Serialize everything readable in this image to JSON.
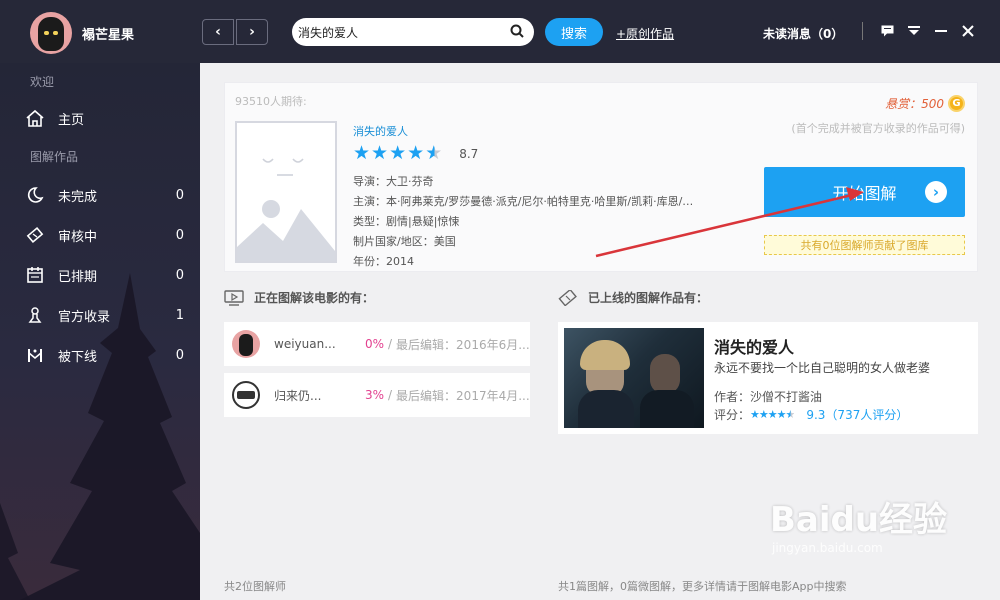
{
  "user": {
    "name": "褟芒星果"
  },
  "topbar": {
    "search_value": "消失的爱人",
    "search_button": "搜索",
    "original_link": "+原创作品",
    "unread": "未读消息（0）"
  },
  "sidebar": {
    "welcome": "欢迎",
    "home": "主页",
    "works_label": "图解作品",
    "items": [
      {
        "label": "未完成",
        "count": "0"
      },
      {
        "label": "审核中",
        "count": "0"
      },
      {
        "label": "已排期",
        "count": "0"
      },
      {
        "label": "官方收录",
        "count": "1"
      },
      {
        "label": "被下线",
        "count": "0"
      }
    ]
  },
  "movie": {
    "expect": "93510人期待:",
    "title": "消失的爱人",
    "rating": "8.7",
    "director": "导演：大卫·芬奇",
    "cast": "主演：本·阿弗莱克/罗莎曼德·派克/尼尔·帕特里克·哈里斯/凯莉·库恩/…",
    "genre": "类型：剧情|悬疑|惊悚",
    "region": "制片国家/地区：美国",
    "year": "年份：2014",
    "star_rating_fraction": 0.87
  },
  "bounty": {
    "label": "悬赏：500",
    "coin": "G",
    "note": "(首个完成并被官方收录的作品可得)"
  },
  "start_button": "开始图解",
  "contrib_note": "共有0位图解师贡献了图库",
  "editing": {
    "title": "正在图解该电影的有：",
    "rows": [
      {
        "name": "weiyuan...",
        "percent": "0%",
        "sep": "/",
        "time": "最后编辑：2016年6月..."
      },
      {
        "name": "归来仍...",
        "percent": "3%",
        "sep": "/",
        "time": "最后编辑：2017年4月..."
      }
    ],
    "footer": "共2位图解师"
  },
  "published": {
    "title": "已上线的图解作品有：",
    "work": {
      "title": "消失的爱人",
      "tagline": "永远不要找一个比自己聪明的女人做老婆",
      "author": "作者：沙僧不打酱油",
      "rating_label": "评分：",
      "score": "9.3（737人评分）",
      "star_rating_fraction": 0.93
    },
    "footer": "共1篇图解，0篇微图解，更多详情请于图解电影App中搜索"
  },
  "watermark": {
    "main": "Baidu经验",
    "sub": "jingyan.baidu.com"
  },
  "colors": {
    "accent": "#1da1f2",
    "sidebar": "#262838",
    "highlight": "#e2418f",
    "bounty": "#e2613a",
    "annotation_arrow": "#d9353a"
  }
}
